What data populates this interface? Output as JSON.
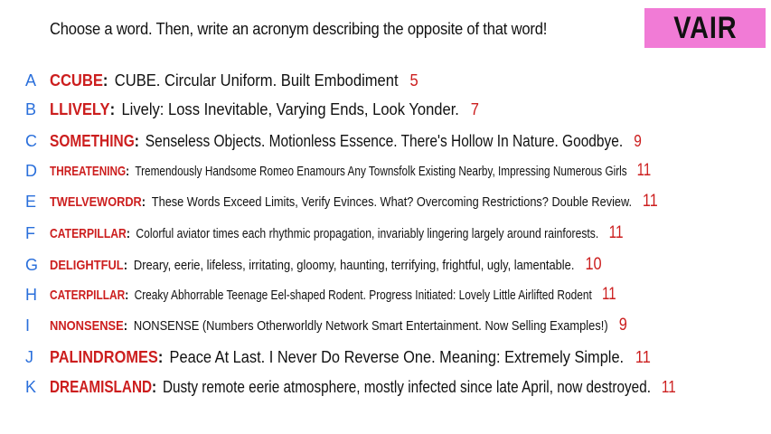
{
  "header": {
    "prompt": "Choose a word. Then, write an acronym describing the opposite of that word!",
    "badge": "VAIR"
  },
  "entries": [
    {
      "letter": "A",
      "word": "CCUBE",
      "acronym": "CUBE. Circular Uniform. Built Embodiment",
      "score": "5"
    },
    {
      "letter": "B",
      "word": "LLIVELY",
      "acronym": "Lively: Loss Inevitable, Varying Ends, Look Yonder.",
      "score": "7"
    },
    {
      "letter": "C",
      "word": "SOMETHING",
      "acronym": "Senseless Objects. Motionless Essence. There's Hollow In Nature. Goodbye.",
      "score": "9"
    },
    {
      "letter": "D",
      "word": "THREATENING",
      "acronym": "Tremendously Handsome Romeo Enamours Any Townsfolk Existing Nearby, Impressing Numerous Girls",
      "score": "11"
    },
    {
      "letter": "E",
      "word": "TWELVEWORDR",
      "acronym": "These Words Exceed Limits, Verify Evinces. What? Overcoming Restrictions? Double Review.",
      "score": "11"
    },
    {
      "letter": "F",
      "word": "CATERPILLAR",
      "acronym": "Colorful aviator times each rhythmic propagation, invariably lingering largely around rainforests.",
      "score": "11"
    },
    {
      "letter": "G",
      "word": "DELIGHTFUL",
      "acronym": "Dreary, eerie, lifeless, irritating, gloomy, haunting, terrifying, frightful, ugly, lamentable.",
      "score": "10"
    },
    {
      "letter": "H",
      "word": "CATERPILLAR",
      "acronym": "Creaky Abhorrable Teenage Eel-shaped Rodent. Progress Initiated: Lovely Little Airlifted Rodent",
      "score": "11"
    },
    {
      "letter": "I",
      "word": "NNONSENSE",
      "acronym": "NONSENSE (Numbers Otherworldly Network Smart Entertainment. Now Selling Examples!)",
      "score": "9"
    },
    {
      "letter": "J",
      "word": "PALINDROMES",
      "acronym": "Peace At Last. I Never Do Reverse One. Meaning: Extremely Simple.",
      "score": "11"
    },
    {
      "letter": "K",
      "word": "DREAMISLAND",
      "acronym": "Dusty remote eerie atmosphere, mostly infected since late April, now destroyed.",
      "score": "11"
    }
  ]
}
